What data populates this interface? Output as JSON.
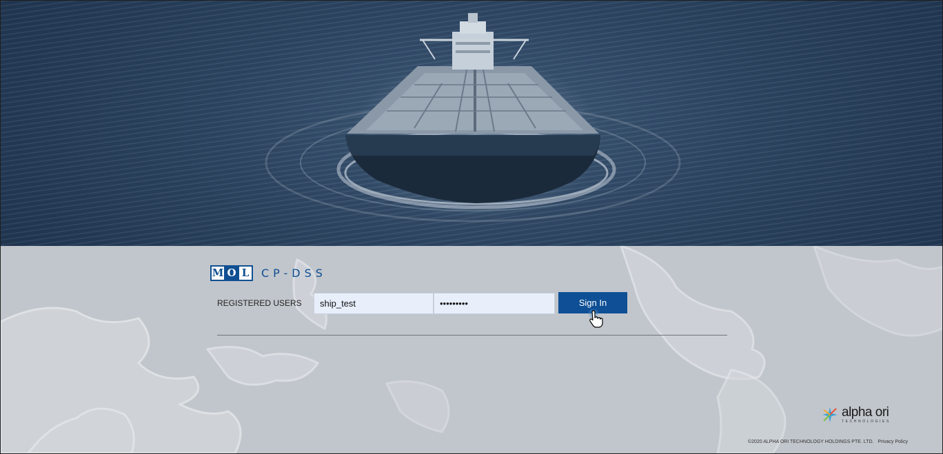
{
  "brand": {
    "mol_letters": [
      "M",
      "O",
      "L"
    ],
    "product": "CP-DSS",
    "accent": "#0f4f92"
  },
  "login": {
    "label": "REGISTERED USERS",
    "username_value": "ship_test",
    "password_value": "•••••••••",
    "signin_label": "Sign In"
  },
  "footer": {
    "copyright": "©2020 ALPHA ORI TECHNOLOGY HOLDINGS PTE. LTD.",
    "privacy": "Privacy Policy"
  },
  "partner": {
    "name": "alpha ori",
    "sub": "TECHNOLOGIES",
    "icon": "alpha-ori-star-icon"
  }
}
